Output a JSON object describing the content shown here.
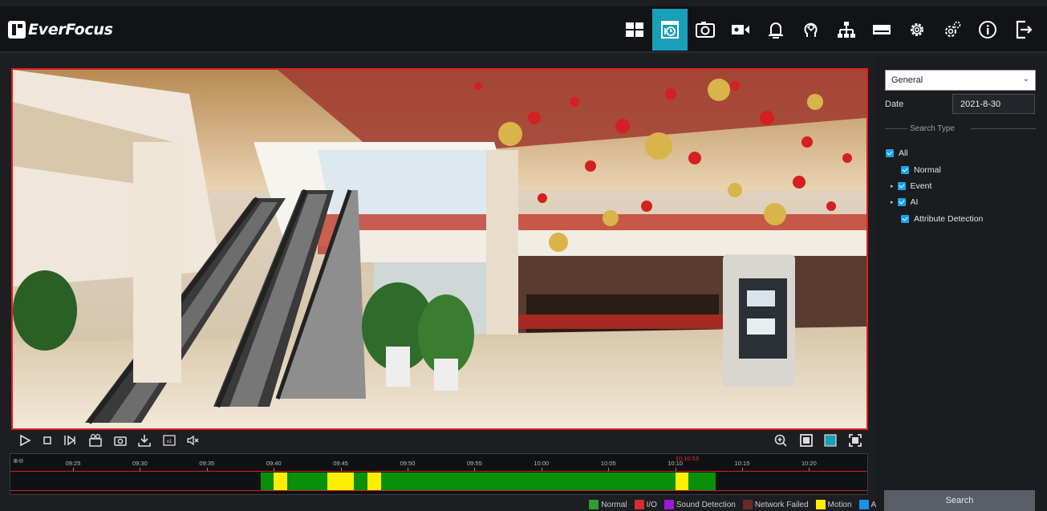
{
  "app": {
    "logo_text": "EverFocus"
  },
  "nav": {
    "items": [
      {
        "name": "live-view",
        "icon": "grid-icon",
        "active": false
      },
      {
        "name": "playback",
        "icon": "playback-icon",
        "active": true
      },
      {
        "name": "snapshot",
        "icon": "snapshot-icon",
        "active": false
      },
      {
        "name": "record",
        "icon": "record-icon",
        "active": false
      },
      {
        "name": "alarm",
        "icon": "bell-icon",
        "active": false
      },
      {
        "name": "ai",
        "icon": "ai-head-icon",
        "active": false
      },
      {
        "name": "network",
        "icon": "network-icon",
        "active": false
      },
      {
        "name": "storage",
        "icon": "storage-icon",
        "active": false
      },
      {
        "name": "settings",
        "icon": "gear-icon",
        "active": false
      },
      {
        "name": "advanced",
        "icon": "gears-icon",
        "active": false
      },
      {
        "name": "info",
        "icon": "info-icon",
        "active": false
      },
      {
        "name": "logout",
        "icon": "logout-icon",
        "active": false
      }
    ],
    "accent": "#18a0b8"
  },
  "panel": {
    "mode": "General",
    "date_label": "Date",
    "date_value": "2021-8-30",
    "search_type_title": "Search Type",
    "types": [
      {
        "label": "All",
        "checked": true,
        "expandable": false,
        "indent": 0
      },
      {
        "label": "Normal",
        "checked": true,
        "expandable": false,
        "indent": 1
      },
      {
        "label": "Event",
        "checked": true,
        "expandable": true,
        "indent": 1
      },
      {
        "label": "AI",
        "checked": true,
        "expandable": true,
        "indent": 1
      },
      {
        "label": "Attribute Detection",
        "checked": true,
        "expandable": false,
        "indent": 1
      }
    ],
    "search_button": "Search"
  },
  "timeline": {
    "ticks": [
      "09:25",
      "09:30",
      "09:35",
      "09:40",
      "09:45",
      "09:50",
      "09:55",
      "10:00",
      "10:05",
      "10:10",
      "10:15",
      "10:20"
    ],
    "cursor_time": "10:10:53",
    "colors": {
      "normal": "#0a8f0a",
      "motion": "#ffee00",
      "cursor": "#e03030"
    },
    "segments": [
      {
        "type": "normal",
        "start": "09:39",
        "end": "10:13"
      },
      {
        "type": "motion",
        "start": "09:40",
        "end": "09:41"
      },
      {
        "type": "motion",
        "start": "09:44",
        "end": "09:45"
      },
      {
        "type": "motion",
        "start": "09:45",
        "end": "09:46"
      },
      {
        "type": "motion",
        "start": "09:47",
        "end": "09:48"
      },
      {
        "type": "motion",
        "start": "10:10",
        "end": "10:11"
      }
    ]
  },
  "legend": [
    {
      "label": "Normal",
      "color": "#2e9e2e"
    },
    {
      "label": "I/O",
      "color": "#d42e2e"
    },
    {
      "label": "Sound Detection",
      "color": "#9a1ad6"
    },
    {
      "label": "Network Failed",
      "color": "#6b2a2a"
    },
    {
      "label": "Motion",
      "color": "#ffee00"
    },
    {
      "label": "AI",
      "color": "#1a8fe8"
    }
  ],
  "controls": [
    {
      "name": "play-icon"
    },
    {
      "name": "stop-icon"
    },
    {
      "name": "step-forward-icon"
    },
    {
      "name": "clip-icon"
    },
    {
      "name": "camera-icon"
    },
    {
      "name": "download-icon"
    },
    {
      "name": "speed-icon",
      "label": "x1"
    },
    {
      "name": "mute-icon"
    }
  ]
}
